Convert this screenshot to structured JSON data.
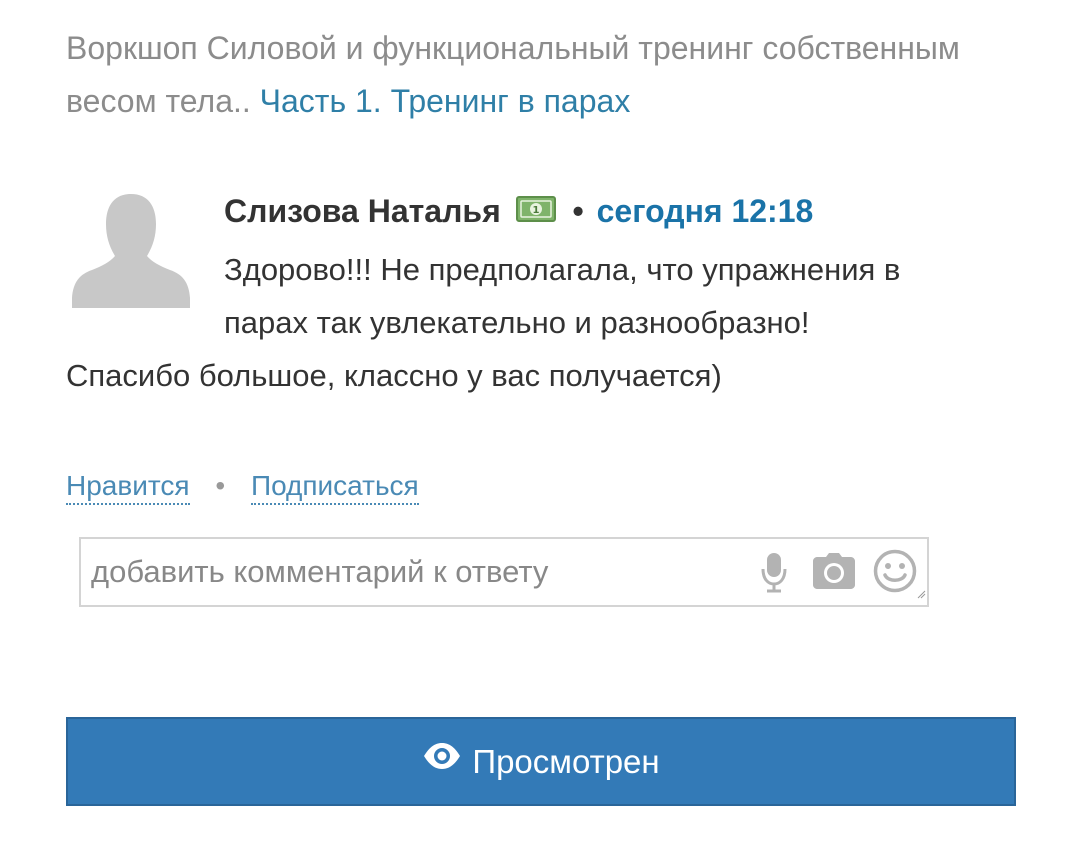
{
  "header": {
    "text": "Воркшоп Силовой и функциональный тренинг собственным весом тела..",
    "link_text": "Часть 1. Тренинг в парах"
  },
  "comment": {
    "avatar_icon": "user-silhouette-icon",
    "author": "Слизова Наталья",
    "badge_icon": "money-icon",
    "separator": "•",
    "time": "сегодня 12:18",
    "text_line1": "Здорово!!! Не предполагала, что упражнения в",
    "text_line2": "парах так увлекательно и разнообразно!",
    "text_line3": "Спасибо большое, классно у вас получается)"
  },
  "actions": {
    "like_label": "Нравится",
    "separator": "•",
    "subscribe_label": "Подписаться"
  },
  "reply_input": {
    "placeholder": "добавить комментарий к ответу",
    "value": "",
    "icons": [
      "microphone-icon",
      "camera-icon",
      "smiley-icon"
    ]
  },
  "viewed_button": {
    "icon": "eye-icon",
    "label": "Просмотрен"
  },
  "colors": {
    "link": "#2f7fa7",
    "time": "#1a73a8",
    "button_bg": "#337ab7",
    "text": "#333333",
    "muted": "#8c8c8c"
  }
}
